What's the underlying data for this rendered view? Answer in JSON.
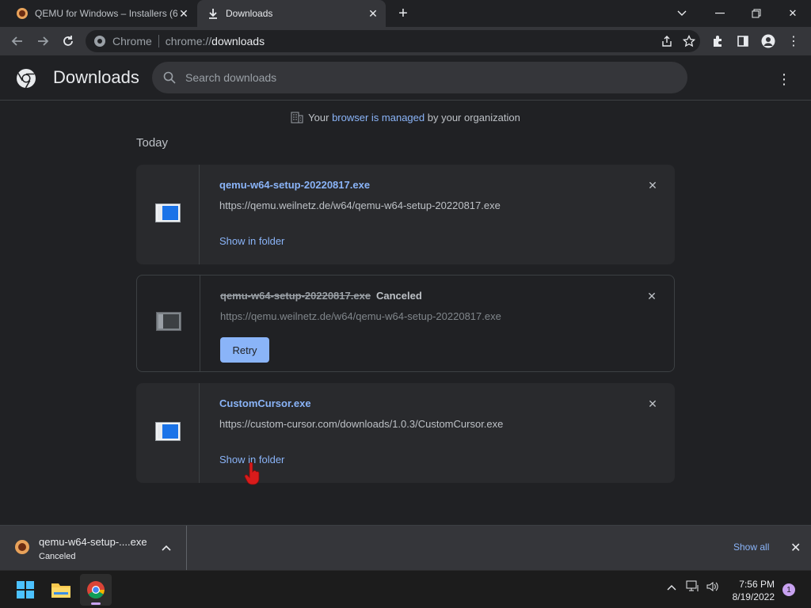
{
  "tabs": [
    {
      "title": "QEMU for Windows – Installers (6",
      "favicon": "qemu-icon"
    },
    {
      "title": "Downloads",
      "favicon": "download-icon"
    }
  ],
  "omnibox": {
    "site": "Chrome",
    "url_prefix": "chrome://",
    "url_host": "downloads"
  },
  "page": {
    "title": "Downloads",
    "search_placeholder": "Search downloads",
    "managed": {
      "prefix": "Your",
      "link": "browser is managed",
      "suffix": "by your organization"
    },
    "section": "Today"
  },
  "downloads": [
    {
      "filename": "qemu-w64-setup-20220817.exe",
      "url": "https://qemu.weilnetz.de/w64/qemu-w64-setup-20220817.exe",
      "action": "Show in folder",
      "status": ""
    },
    {
      "filename": "qemu-w64-setup-20220817.exe",
      "url": "https://qemu.weilnetz.de/w64/qemu-w64-setup-20220817.exe",
      "action": "Retry",
      "status": "Canceled"
    },
    {
      "filename": "CustomCursor.exe",
      "url": "https://custom-cursor.com/downloads/1.0.3/CustomCursor.exe",
      "action": "Show in folder",
      "status": ""
    }
  ],
  "shelf": {
    "name": "qemu-w64-setup-....exe",
    "status": "Canceled",
    "show_all": "Show all"
  },
  "taskbar": {
    "time": "7:56 PM",
    "date": "8/19/2022",
    "notifications": "1"
  },
  "colors": {
    "accent": "#8ab4f8",
    "background": "#202124",
    "card": "#292a2d"
  }
}
